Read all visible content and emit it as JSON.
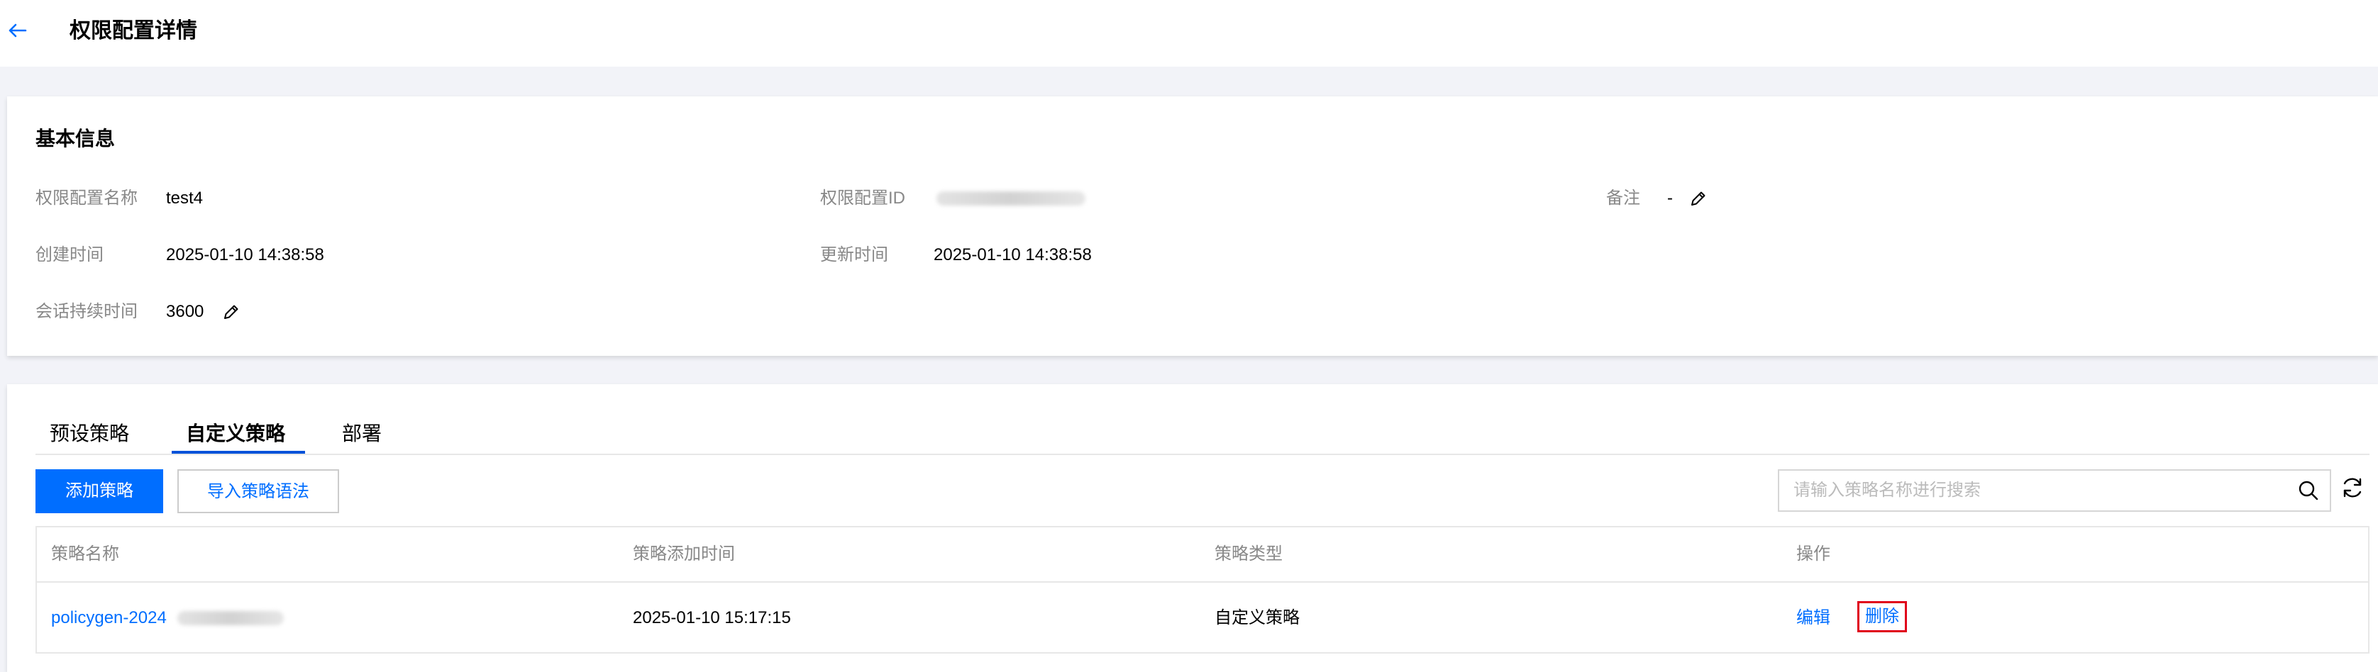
{
  "header": {
    "back_icon": "arrow-left-icon",
    "title": "权限配置详情"
  },
  "basic_info": {
    "title": "基本信息",
    "fields": {
      "name_label": "权限配置名称",
      "name_value": "test4",
      "id_label": "权限配置ID",
      "remark_label": "备注",
      "remark_value": "-",
      "created_label": "创建时间",
      "created_value": "2025-01-10 14:38:58",
      "updated_label": "更新时间",
      "updated_value": "2025-01-10 14:38:58",
      "session_label": "会话持续时间",
      "session_value": "3600"
    },
    "edit_icon": "pencil-icon"
  },
  "tabs": [
    {
      "label": "预设策略"
    },
    {
      "label": "自定义策略",
      "active": true
    },
    {
      "label": "部署"
    }
  ],
  "toolbar": {
    "add_label": "添加策略",
    "import_label": "导入策略语法",
    "search_placeholder": "请输入策略名称进行搜索",
    "search_icon": "search-icon",
    "refresh_icon": "refresh-icon"
  },
  "table": {
    "columns": [
      "策略名称",
      "策略添加时间",
      "策略类型",
      "操作"
    ],
    "rows": [
      {
        "name": "policygen-2024",
        "added_time": "2025-01-10 15:17:15",
        "type": "自定义策略",
        "edit": "编辑",
        "delete": "删除"
      }
    ]
  },
  "colors": {
    "primary": "#006eff",
    "tab_active": "#0052d9",
    "highlight_border": "#e0001b",
    "page_bg": "#f2f3f8"
  }
}
